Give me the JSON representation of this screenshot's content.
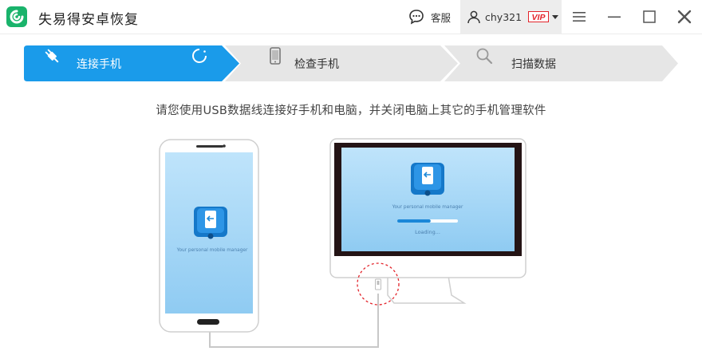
{
  "app": {
    "title": "失易得安卓恢复",
    "service_label": "客服",
    "username": "chy321",
    "vip_label": "VIP"
  },
  "steps": [
    {
      "label": "连接手机",
      "active": true,
      "icon": "usb-plug-icon"
    },
    {
      "label": "检查手机",
      "active": false,
      "icon": "phone-icon"
    },
    {
      "label": "扫描数据",
      "active": false,
      "icon": "magnifier-icon"
    }
  ],
  "instruction": "请您使用USB数据线连接好手机和电脑，并关闭电脑上其它的手机管理软件",
  "illustration": {
    "phone_tagline": "Your personal mobile manager",
    "monitor_tagline": "Your personal mobile manager",
    "loading_text": "Loading...",
    "loading_progress": 0.55
  },
  "colors": {
    "accent": "#1a9bea",
    "logo_green": "#19b36b",
    "step_inactive": "#e6e6e6",
    "vip_red": "#e3242b"
  }
}
